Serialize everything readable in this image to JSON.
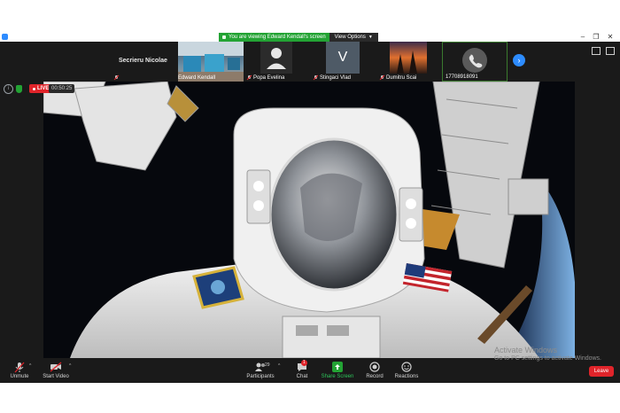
{
  "titlebar": {
    "share_message": "You are viewing Edward Kendall's screen",
    "view_options": "View Options"
  },
  "filmstrip": {
    "active_speaker": "Secrieru Nicolae",
    "tiles": [
      {
        "name": "Edward Kendall",
        "kind": "video"
      },
      {
        "name": "Popa Evelina",
        "kind": "avatar"
      },
      {
        "name": "Stingaci Vlad",
        "kind": "initial",
        "initial": "V"
      },
      {
        "name": "Dumitru Scai",
        "kind": "video"
      },
      {
        "name": "17708918091",
        "kind": "phone"
      }
    ]
  },
  "stage": {
    "live_label": "LIVE",
    "timer": "00:50:25"
  },
  "toolbar": {
    "unmute": "Unmute",
    "start_video": "Start Video",
    "participants": "Participants",
    "participants_count": "29",
    "chat": "Chat",
    "chat_badge": "1",
    "share_screen": "Share Screen",
    "record": "Record",
    "reactions": "Reactions",
    "leave": "Leave"
  },
  "watermark": {
    "line1": "Activate Windows",
    "line2": "Go to PC settings to activate Windows."
  },
  "colors": {
    "accent": "#2d8cff",
    "share_green": "#23a334",
    "leave_red": "#e0242a",
    "toolbar_bg": "#1a1a1a"
  }
}
